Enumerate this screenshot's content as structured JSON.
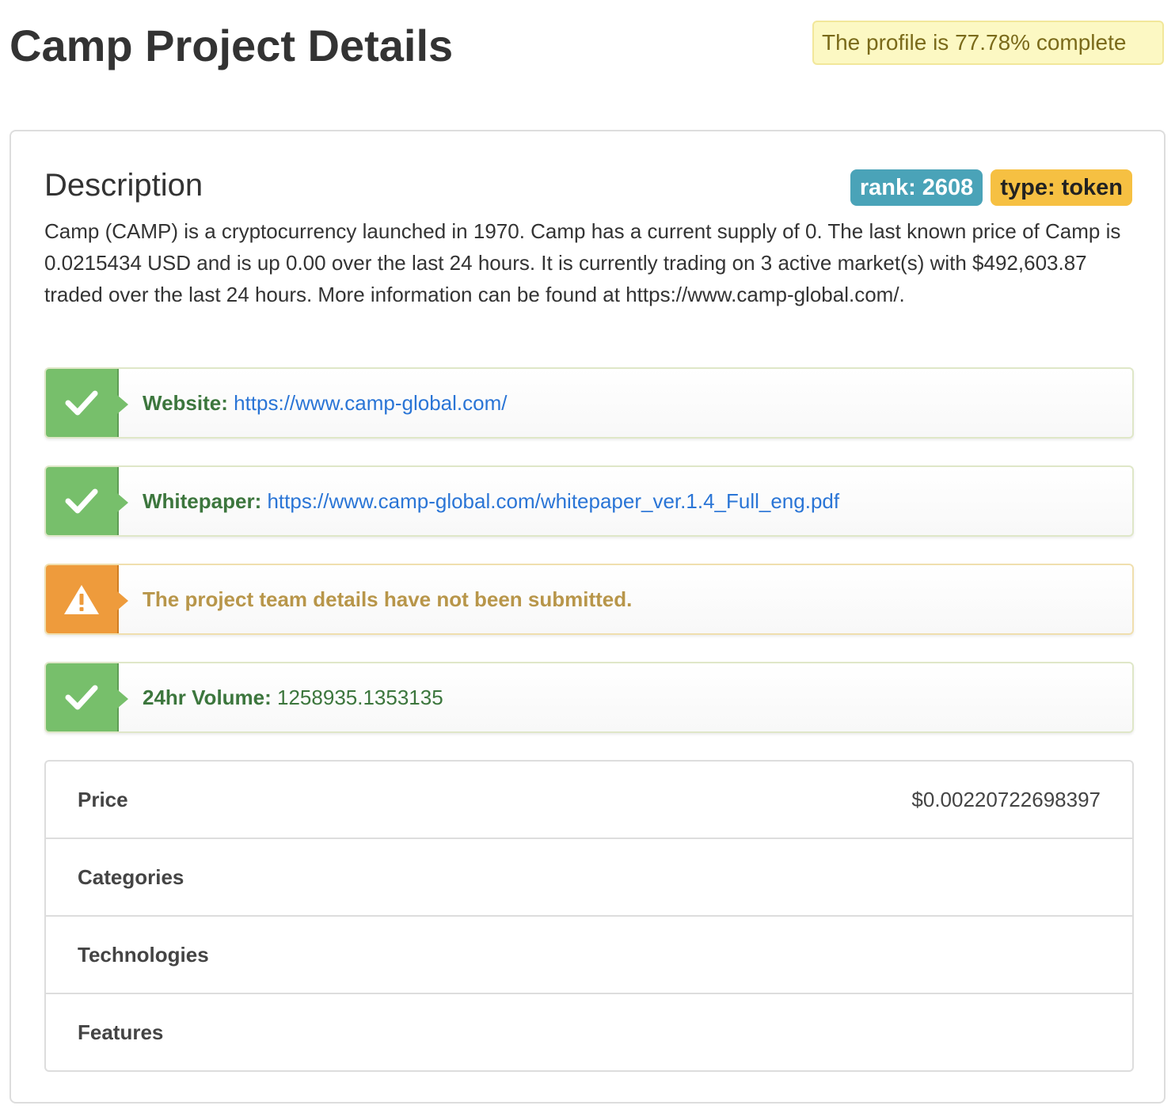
{
  "page": {
    "title": "Camp Project Details",
    "profile_status": "The profile is 77.78% complete"
  },
  "description_section": {
    "title": "Description",
    "badges": {
      "rank": "rank: 2608",
      "type": "type: token"
    },
    "text": "Camp (CAMP) is a cryptocurrency launched in 1970. Camp has a current supply of 0. The last known price of Camp is 0.0215434 USD and is up 0.00 over the last 24 hours. It is currently trading on 3 active market(s) with $492,603.87 traded over the last 24 hours. More information can be found at https://www.camp-global.com/."
  },
  "checks": {
    "website": {
      "label": "Website:",
      "value": "https://www.camp-global.com/",
      "status": "ok",
      "icon": "checkmark-icon"
    },
    "whitepaper": {
      "label": "Whitepaper:",
      "value": "https://www.camp-global.com/whitepaper_ver.1.4_Full_eng.pdf",
      "status": "ok",
      "icon": "checkmark-icon"
    },
    "team": {
      "message": "The project team details have not been submitted.",
      "status": "warning",
      "icon": "warning-triangle-icon"
    },
    "volume": {
      "label": "24hr Volume:",
      "value": "1258935.1353135",
      "status": "ok",
      "icon": "checkmark-icon"
    }
  },
  "details_table": {
    "price_label": "Price",
    "price_value": "$0.00220722698397",
    "categories_label": "Categories",
    "technologies_label": "Technologies",
    "features_label": "Features"
  },
  "colors": {
    "success": "#77bf6b",
    "warning": "#ee9b3c",
    "rank_badge": "#4aa3b8",
    "type_badge": "#f6c042",
    "link": "#2a75d6"
  }
}
